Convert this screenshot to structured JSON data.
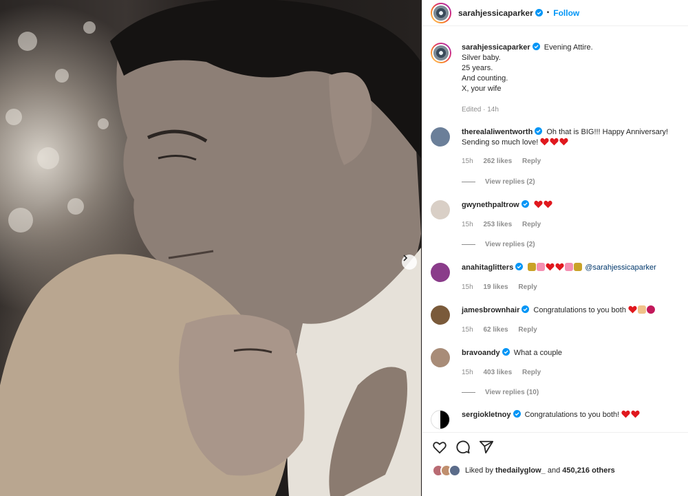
{
  "post": {
    "author": "sarahjessicaparker",
    "follow_label": "Follow",
    "dot": "•",
    "caption_lines": [
      "Evening Attire.",
      "Silver baby.",
      "25 years.",
      "And counting.",
      "X, your wife"
    ],
    "edited": "Edited · 14h"
  },
  "comments": [
    {
      "user": "therealaliwentworth",
      "text": "Oh that is BIG!!! Happy Anniversary!",
      "text2": "Sending so much love!",
      "time": "15h",
      "likes": "262 likes",
      "reply": "Reply",
      "view_replies": "View replies (2)",
      "avatar_color": "#6b7f99"
    },
    {
      "user": "gwynethpaltrow",
      "text": "",
      "time": "15h",
      "likes": "253 likes",
      "reply": "Reply",
      "view_replies": "View replies (2)",
      "avatar_color": "#d9cfc6"
    },
    {
      "user": "anahitaglitters",
      "text": "@sarahjessicaparker",
      "time": "15h",
      "likes": "19 likes",
      "reply": "Reply",
      "avatar_color": "#8a3c8a"
    },
    {
      "user": "jamesbrownhair",
      "text": "Congratulations to you both",
      "time": "15h",
      "likes": "62 likes",
      "reply": "Reply",
      "avatar_color": "#7a5a3a"
    },
    {
      "user": "bravoandy",
      "text": "What a couple",
      "time": "15h",
      "likes": "403 likes",
      "reply": "Reply",
      "view_replies": "View replies (10)",
      "avatar_color": "#a88c78"
    },
    {
      "user": "sergiokletnoy",
      "text": "Congratulations to you both!",
      "avatar_color": "#000000"
    }
  ],
  "liked_by": {
    "prefix": "Liked by",
    "user": "thedailyglow_",
    "and": "and",
    "count": "450,216 others"
  },
  "colors": {
    "accent": "#0095f6",
    "heart": "#ed4956",
    "muted": "#8e8e8e"
  },
  "icons": [
    "verified-badge-icon",
    "heart-icon",
    "comment-icon",
    "share-icon",
    "chevron-right-icon"
  ]
}
